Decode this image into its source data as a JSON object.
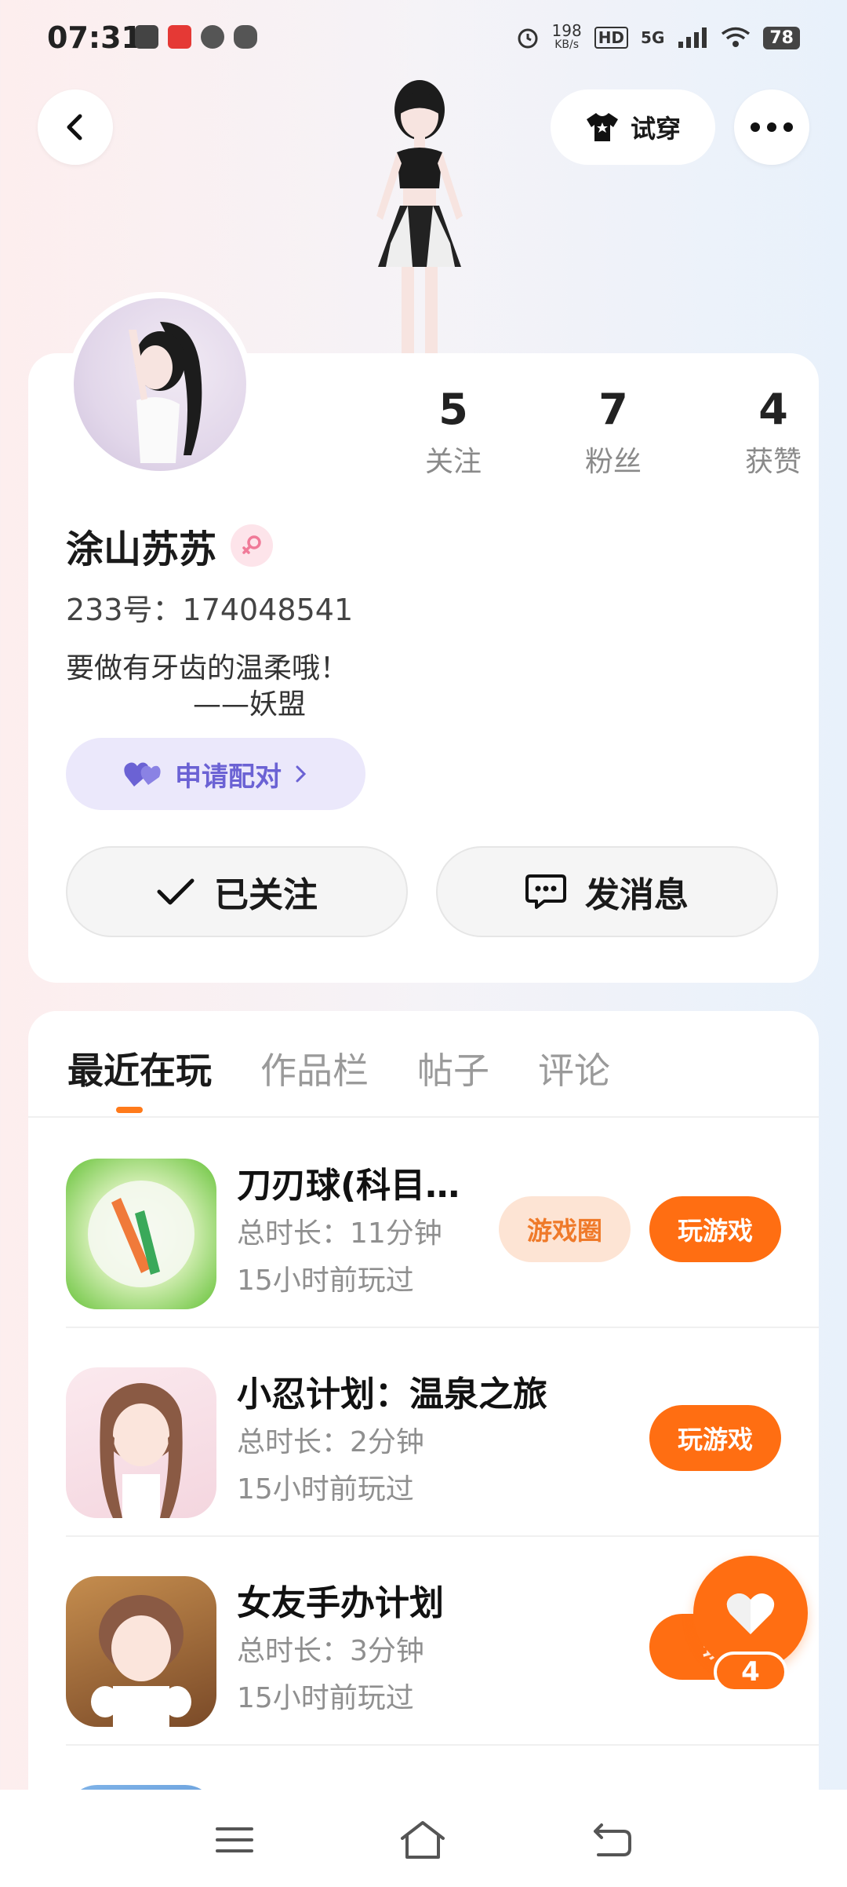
{
  "status_bar": {
    "time": "07:31",
    "net_speed_value": "198",
    "net_speed_unit": "KB/s",
    "hd": "HD",
    "network": "5G",
    "battery": "78",
    "app_icons": [
      "gallery-icon",
      "xiaohongshu-icon",
      "link-icon",
      "wechat-icon"
    ]
  },
  "header": {
    "back_icon": "chevron-left-icon",
    "try_on_label": "试穿",
    "more_icon": "more-dots-icon"
  },
  "profile": {
    "stats": [
      {
        "value": "5",
        "label": "关注"
      },
      {
        "value": "7",
        "label": "粉丝"
      },
      {
        "value": "4",
        "label": "获赞"
      }
    ],
    "name": "涂山苏苏",
    "gender_icon": "female-icon",
    "uid": "233号：174048541",
    "bio_line1": "要做有牙齿的温柔哦！",
    "bio_line2": "——妖盟",
    "pair_label": "申请配对",
    "follow_label": "已关注",
    "message_label": "发消息"
  },
  "tabs": [
    {
      "label": "最近在玩",
      "active": true
    },
    {
      "label": "作品栏",
      "active": false
    },
    {
      "label": "帖子",
      "active": false
    },
    {
      "label": "评论",
      "active": false
    }
  ],
  "games": [
    {
      "title": "刀刃球(科目…",
      "duration": "总时长：11分钟",
      "last_played": "15小时前玩过",
      "circle_label": "游戏圈",
      "play_label": "玩游戏"
    },
    {
      "title": "小忍计划：温泉之旅",
      "duration": "总时长：2分钟",
      "last_played": "15小时前玩过",
      "play_label": "玩游戏"
    },
    {
      "title": "女友手办计划",
      "duration": "总时长：3分钟",
      "last_played": "15小时前玩过",
      "play_label": "玩"
    }
  ],
  "like_button": {
    "count": "4"
  },
  "colors": {
    "accent": "#ff6e12",
    "pair_text": "#6b62d4",
    "pair_bg": "#ebe8fb"
  }
}
